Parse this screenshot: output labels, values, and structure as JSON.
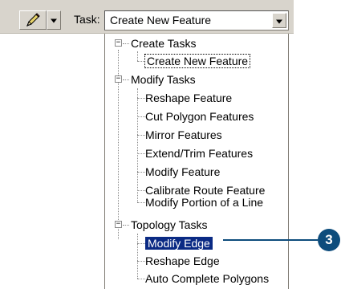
{
  "toolbar": {
    "task_label": "Task:",
    "task_value": "Create New Feature",
    "pencil_icon": "pencil-icon",
    "dropdown_icon": "triangle-down-icon"
  },
  "tree": {
    "groups": [
      {
        "label": "Create Tasks",
        "expanded": true,
        "items": [
          "Create New Feature"
        ]
      },
      {
        "label": "Modify Tasks",
        "expanded": true,
        "items": [
          "Reshape Feature",
          "Cut Polygon Features",
          "Mirror Features",
          "Extend/Trim Features",
          "Modify Feature",
          "Calibrate Route Feature",
          "Modify Portion of a Line"
        ]
      },
      {
        "label": "Topology Tasks",
        "expanded": true,
        "items": [
          "Modify Edge",
          "Reshape Edge",
          "Auto Complete Polygons"
        ]
      }
    ],
    "toggle_symbol": "−"
  },
  "callout": {
    "number": "3",
    "color": "#0d4c7c"
  },
  "colors": {
    "toolbar_bg": "#d8d4cc",
    "highlight_bg": "#0a2a84"
  }
}
